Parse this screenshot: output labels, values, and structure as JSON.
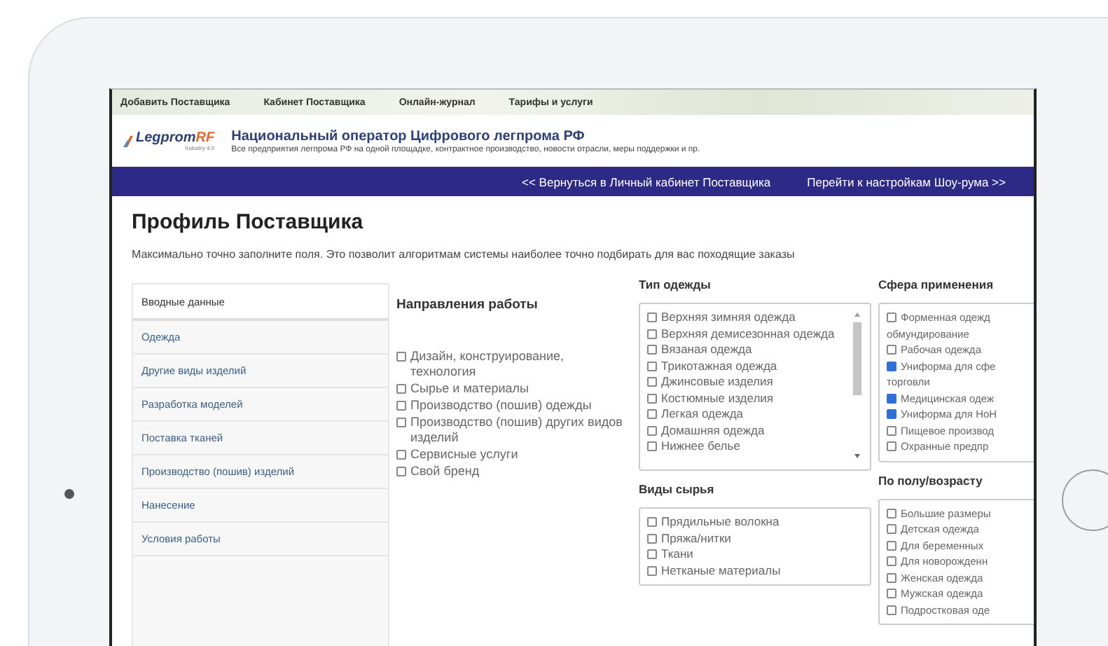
{
  "top_nav": [
    "Добавить Поставщика",
    "Кабинет Поставщика",
    "Онлайн-журнал",
    "Тарифы и услуги"
  ],
  "header": {
    "logo_main": "Legprom",
    "logo_accent": "RF",
    "logo_tagline": "Industry 4.0",
    "title": "Национальный оператор Цифрового легпрома РФ",
    "subtitle": "Все предприятия легпрома РФ на одной площадке, контрактное производство, новости отрасли, меры поддержки и пр."
  },
  "action_bar": [
    "<< Вернуться в Личный кабинет Поставщика",
    "Перейти к настройкам Шоу-рума >>"
  ],
  "page_title": "Профиль Поставщика",
  "intro": "Максимально точно заполните поля. Это позволит алгоритмам системы наиболее точно подбирать для вас походящие заказы",
  "sidebar": [
    {
      "label": "Вводные данные",
      "selected": true
    },
    {
      "label": "Одежда",
      "selected": false
    },
    {
      "label": "Другие виды изделий",
      "selected": false
    },
    {
      "label": "Разработка моделей",
      "selected": false
    },
    {
      "label": "Поставка тканей",
      "selected": false
    },
    {
      "label": "Производство (пошив) изделий",
      "selected": false
    },
    {
      "label": "Нанесение",
      "selected": false
    },
    {
      "label": "Условия работы",
      "selected": false
    }
  ],
  "work_directions": {
    "title": "Направления работы",
    "items": [
      {
        "label": "Дизайн, конструирование, технология",
        "checked": false
      },
      {
        "label": "Сырье и материалы",
        "checked": false
      },
      {
        "label": "Производство (пошив) одежды",
        "checked": false
      },
      {
        "label": "Производство (пошив) других видов изделий",
        "checked": false
      },
      {
        "label": "Сервисные услуги",
        "checked": false
      },
      {
        "label": "Свой бренд",
        "checked": false
      }
    ]
  },
  "clothing_type": {
    "title": "Тип одежды",
    "items": [
      {
        "label": "Верхняя зимняя одежда",
        "checked": false
      },
      {
        "label": "Верхняя демисезонная одежда",
        "checked": false
      },
      {
        "label": "Вязаная одежда",
        "checked": false
      },
      {
        "label": "Трикотажная одежда",
        "checked": false
      },
      {
        "label": "Джинсовые изделия",
        "checked": false
      },
      {
        "label": "Костюмные изделия",
        "checked": false
      },
      {
        "label": "Легкая одежда",
        "checked": false
      },
      {
        "label": "Домашняя одежда",
        "checked": false
      },
      {
        "label": "Нижнее белье",
        "checked": false
      }
    ]
  },
  "application": {
    "title": "Сфера применения",
    "items": [
      {
        "label": "Форменная одежд",
        "checked": false
      },
      {
        "label": "обмундирование"
      },
      {
        "label": "Рабочая одежда",
        "checked": false
      },
      {
        "label": "Униформа для сфе",
        "checked": true
      },
      {
        "label": "торговли"
      },
      {
        "label": "Медицинская одеж",
        "checked": true
      },
      {
        "label": "Униформа для HoH",
        "checked": true
      },
      {
        "label": "Пищевое производ",
        "checked": false
      },
      {
        "label": "Охранные предпр",
        "checked": false
      }
    ]
  },
  "raw_materials": {
    "title": "Виды сырья",
    "items": [
      {
        "label": "Прядильные волокна",
        "checked": false
      },
      {
        "label": "Пряжа/нитки",
        "checked": false
      },
      {
        "label": "Ткани",
        "checked": false
      },
      {
        "label": "Нетканые материалы",
        "checked": false
      }
    ]
  },
  "gender_age": {
    "title": "По полу/возрасту",
    "items": [
      {
        "label": "Большие размеры",
        "checked": false
      },
      {
        "label": "Детская одежда",
        "checked": false
      },
      {
        "label": "Для беременных",
        "checked": false
      },
      {
        "label": "Для новорожденн",
        "checked": false
      },
      {
        "label": "Женская одежда",
        "checked": false
      },
      {
        "label": "Мужская одежда",
        "checked": false
      },
      {
        "label": "Подростковая оде",
        "checked": false
      }
    ]
  }
}
